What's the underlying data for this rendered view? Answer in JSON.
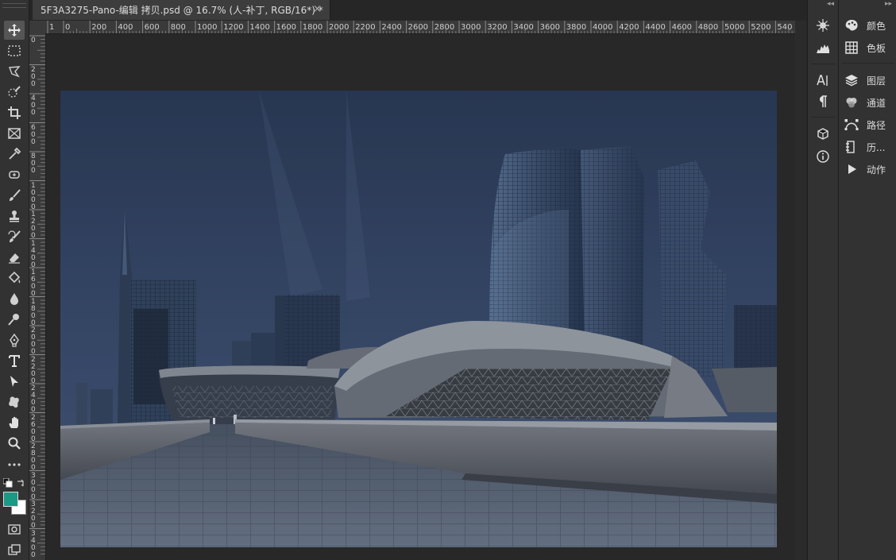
{
  "document": {
    "tab_title": "5F3A3275-Pano-编辑 拷贝.psd @ 16.7% (人-补丁, RGB/16*) *",
    "close_glyph": "×"
  },
  "ruler": {
    "top_ticks": [
      "1",
      "0",
      "200",
      "400",
      "600",
      "800",
      "1000",
      "1200",
      "1400",
      "1600",
      "1800",
      "2000",
      "2200",
      "2400",
      "2600",
      "2800",
      "3000",
      "3200",
      "3400",
      "3600",
      "3800",
      "4000",
      "4200",
      "4400",
      "4600",
      "4800",
      "5000",
      "5200",
      "540"
    ],
    "left_ticks": [
      "0",
      "2\n0\n0",
      "4\n0\n0",
      "6\n0\n0",
      "8\n0\n0",
      "1\n0\n0\n0",
      "1\n2\n0\n0",
      "1\n4\n0\n0",
      "1\n6\n0\n0",
      "1\n8\n0\n0",
      "2\n0\n0\n0",
      "2\n2\n0\n0",
      "2\n4\n0\n0",
      "2\n6\n0\n0",
      "2\n8\n0\n0",
      "3\n0\n0\n0",
      "3\n2\n0\n0",
      "3\n4\n0\n0"
    ]
  },
  "toolbar": {
    "tools": [
      "move-tool",
      "marquee-tool",
      "lasso-tool",
      "quick-selection-tool",
      "crop-tool",
      "frame-tool",
      "eyedropper-tool",
      "healing-brush-tool",
      "brush-tool",
      "clone-stamp-tool",
      "history-brush-tool",
      "eraser-tool",
      "paint-bucket-tool",
      "blur-tool",
      "dodge-tool",
      "pen-tool",
      "type-tool",
      "path-selection-tool",
      "shape-tool",
      "hand-tool",
      "zoom-tool",
      "more-tools"
    ],
    "foreground_color": "#1a9985",
    "background_color": "#ffffff"
  },
  "panels": {
    "items": [
      {
        "label": "颜色",
        "icon": "color-palette-icon"
      },
      {
        "label": "色板",
        "icon": "swatches-grid-icon"
      },
      {
        "label": "图层",
        "icon": "layers-icon"
      },
      {
        "label": "通道",
        "icon": "channels-icon"
      },
      {
        "label": "路径",
        "icon": "paths-icon"
      },
      {
        "label": "历...",
        "icon": "history-icon"
      },
      {
        "label": "动作",
        "icon": "actions-play-icon"
      }
    ],
    "dock_icons": [
      "navigator-icon",
      "histogram-icon",
      "character-icon",
      "paragraph-icon",
      "libraries-icon",
      "info-icon"
    ]
  }
}
